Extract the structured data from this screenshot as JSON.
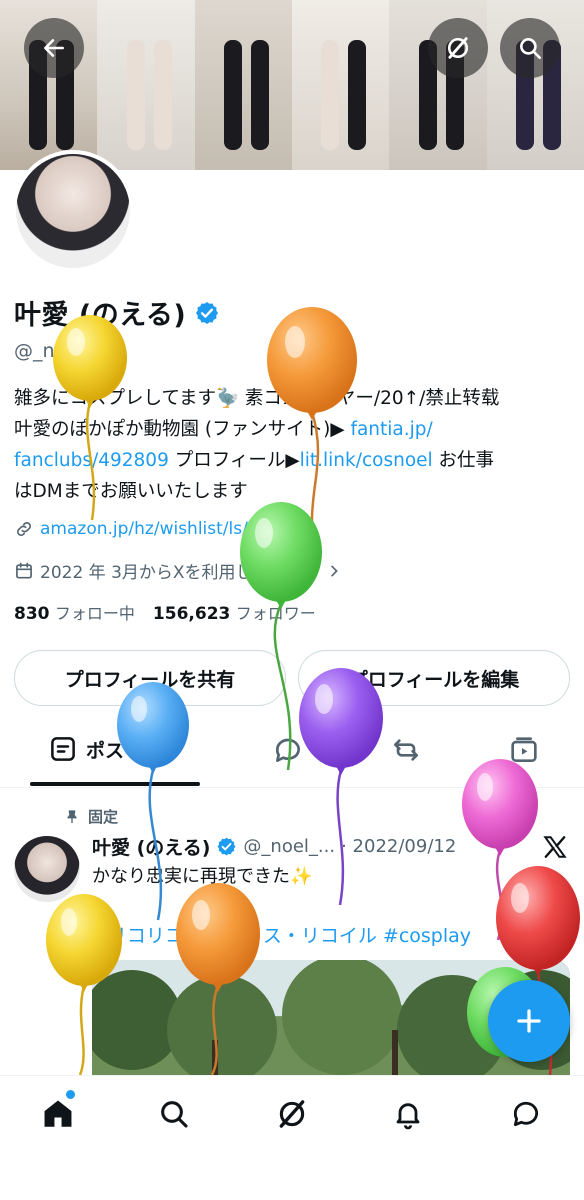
{
  "header": {
    "back_icon": "arrow-left-icon",
    "grok_icon": "grok-icon",
    "search_icon": "search-icon"
  },
  "profile": {
    "name": "叶愛 (のえる)",
    "handle": "@_noel_cos",
    "bio_lines": [
      "雑多にコスプレしてます🦤 素コスレイヤー/20↑/禁止转载",
      "叶愛のぽかぽか動物園 (ファンサイト)▶ ",
      "fanclubs/492809",
      " プロフィール▶",
      "lit.link/cosnoel",
      " お仕事",
      "はDMまでお願いいたします"
    ],
    "bio_link1": "fantia.jp/",
    "website": "amazon.jp/hz/wishlist/ls/...",
    "joined": "2022 年 3月からXを利用しています",
    "following_count": "830",
    "following_label": "フォロー中",
    "followers_count": "156,623",
    "followers_label": "フォロワー",
    "share_button": "プロフィールを共有",
    "edit_button": "プロフィールを編集"
  },
  "tabs": [
    {
      "label": "ポスト"
    }
  ],
  "post": {
    "pinned_label": "固定",
    "author_name": "叶愛 (のえる)",
    "author_handle": "@_noel_...",
    "date": "· 2022/09/12",
    "text": "かなり忠実に再現できた✨",
    "tags": "#リコリコ #リコリス・リコイル #cosplay"
  },
  "colors": {
    "accent": "#1d9bf0",
    "text": "#0f1419",
    "muted": "#536471"
  }
}
